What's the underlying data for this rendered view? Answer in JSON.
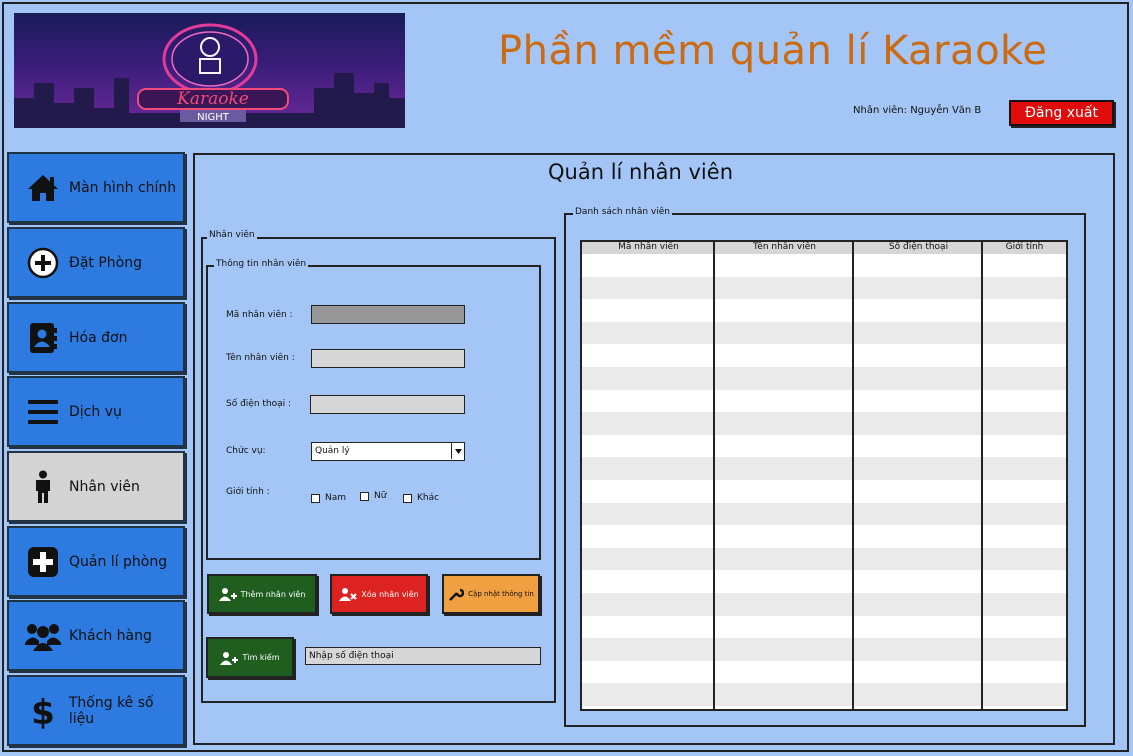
{
  "header": {
    "banner": {
      "logo_text": "Karaoke",
      "logo_sub": "NIGHT"
    },
    "app_title": "Phần mềm quản lí Karaoke",
    "user_label": "Nhân viên: Nguyễn Văn B",
    "logout_label": "Đăng xuất"
  },
  "sidebar": {
    "items": [
      {
        "label": "Màn hình chính",
        "icon": "home-icon"
      },
      {
        "label": "Đặt Phòng",
        "icon": "plus-circle-icon"
      },
      {
        "label": "Hóa đơn",
        "icon": "address-book-icon"
      },
      {
        "label": "Dịch vụ",
        "icon": "menu-icon"
      },
      {
        "label": "Nhân viên",
        "icon": "person-icon",
        "active": true
      },
      {
        "label": "Quản lí phòng",
        "icon": "plus-square-icon"
      },
      {
        "label": "Khách hàng",
        "icon": "group-icon"
      },
      {
        "label": "Thống kê số liệu",
        "icon": "dollar-icon"
      }
    ]
  },
  "main": {
    "title": "Quản lí nhân viên",
    "employee_group": "Nhân viên",
    "info_group": "Thông tin nhân viên",
    "fields": {
      "id_label": "Mã nhân viên :",
      "id_value": "",
      "name_label": "Tên nhân viên :",
      "name_value": "",
      "phone_label": "Số điện thoại :",
      "phone_value": "",
      "role_label": "Chức vụ:",
      "role_value": "Quản lý",
      "gender_label": "Giới tính :",
      "gender_options": [
        "Nam",
        "Nữ",
        "Khác"
      ]
    },
    "buttons": {
      "add": "Thêm nhân viên",
      "delete": "Xóa nhân viên",
      "update": "Cập nhật thông tin",
      "search": "Tìm kiếm"
    },
    "search_placeholder": "Nhập số điện thoại",
    "list_group": "Danh sách nhân viên",
    "table": {
      "columns": [
        "Mã nhân viên",
        "Tên nhân viên",
        "Số điện thoại",
        "Giới tính"
      ],
      "rows": []
    }
  },
  "colors": {
    "background": "#a4c6f6",
    "title": "#cc6a12",
    "nav": "#2d7ae0",
    "nav_active": "#d3d3d3",
    "logout": "#e00b0b",
    "add": "#1f5e1f",
    "delete": "#dd2222",
    "update": "#f0a040"
  }
}
